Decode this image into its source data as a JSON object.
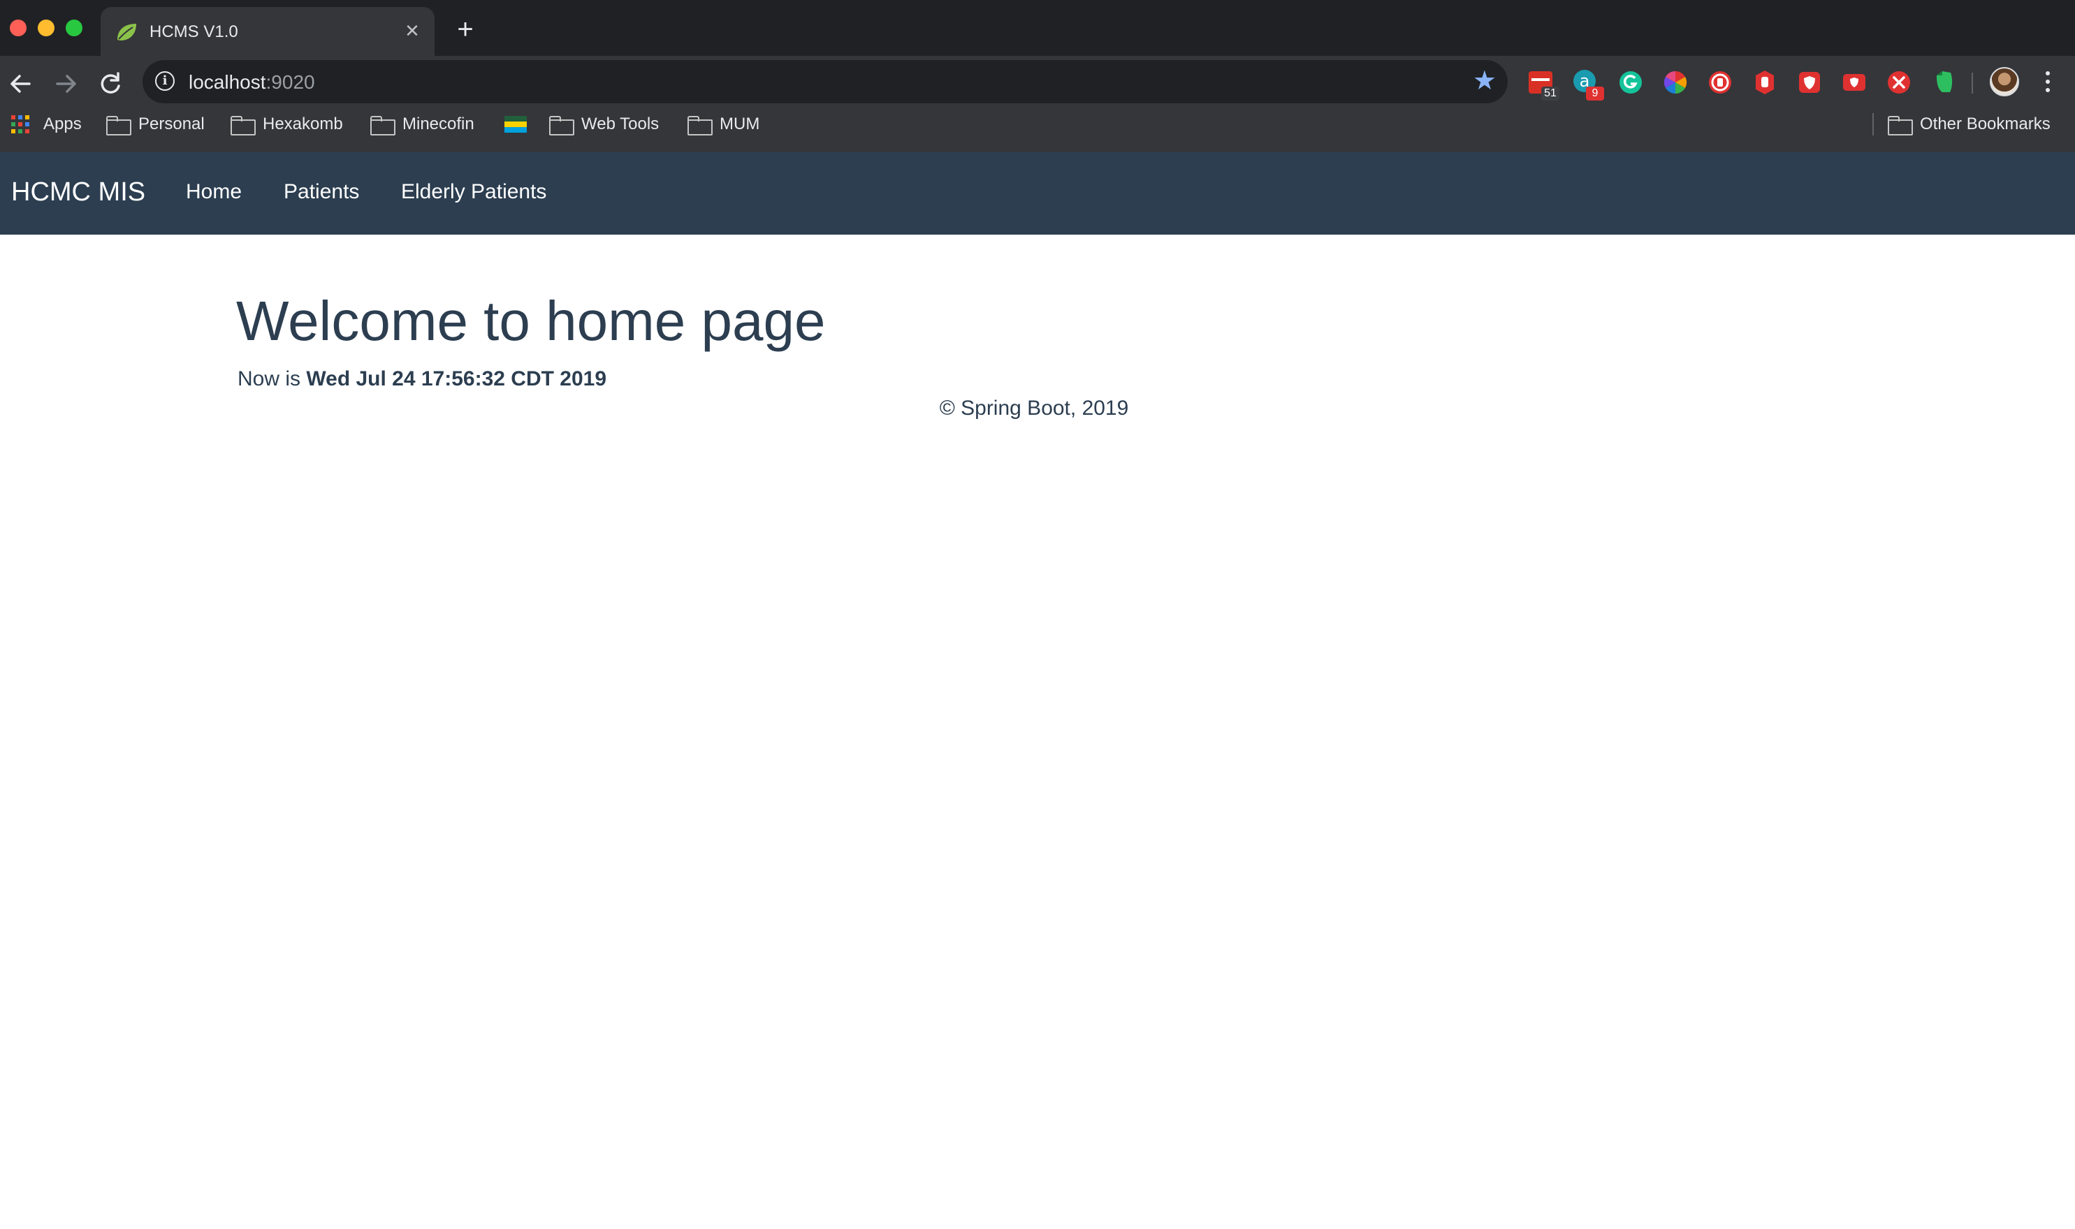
{
  "browser": {
    "tab": {
      "title": "HCMS V1.0",
      "favicon": "spring-leaf-icon",
      "close_glyph": "✕"
    },
    "new_tab_glyph": "+",
    "url": {
      "host": "localhost",
      "port": ":9020"
    },
    "star_glyph": "★",
    "extensions": [
      {
        "name": "calendar-extension-icon",
        "badge": "51",
        "color": "#d93025"
      },
      {
        "name": "a-extension-icon",
        "badge": "9",
        "color": "#1a9bb0"
      },
      {
        "name": "grammarly-icon",
        "badge": "",
        "color": "#15c39a"
      },
      {
        "name": "color-wheel-icon",
        "badge": "",
        "color": "#e8eaed"
      },
      {
        "name": "adblock-icon",
        "badge": "",
        "color": "#e03131"
      },
      {
        "name": "stop-hand-icon",
        "badge": "",
        "color": "#e03131"
      },
      {
        "name": "shield-icon",
        "badge": "",
        "color": "#e03131"
      },
      {
        "name": "shield-alt-icon",
        "badge": "",
        "color": "#e03131"
      },
      {
        "name": "block-x-icon",
        "badge": "",
        "color": "#e03131"
      },
      {
        "name": "evernote-icon",
        "badge": "",
        "color": "#2dbe60"
      }
    ],
    "bookmarks": {
      "apps": "Apps",
      "items": [
        "Personal",
        "Hexakomb",
        "Minecofin",
        "Web Tools",
        "MUM"
      ],
      "other": "Other Bookmarks"
    }
  },
  "app": {
    "brand": "HCMC MIS",
    "nav": [
      "Home",
      "Patients",
      "Elderly Patients"
    ],
    "heading": "Welcome to home page",
    "now_prefix": "Now is",
    "now_value": "Wed Jul 24 17:56:32 CDT 2019",
    "footer": "© Spring Boot, 2019"
  },
  "colors": {
    "navbar": "#2c3e50",
    "text": "#2c3e50",
    "browser_dark": "#202124",
    "browser_toolbar": "#35363a"
  }
}
